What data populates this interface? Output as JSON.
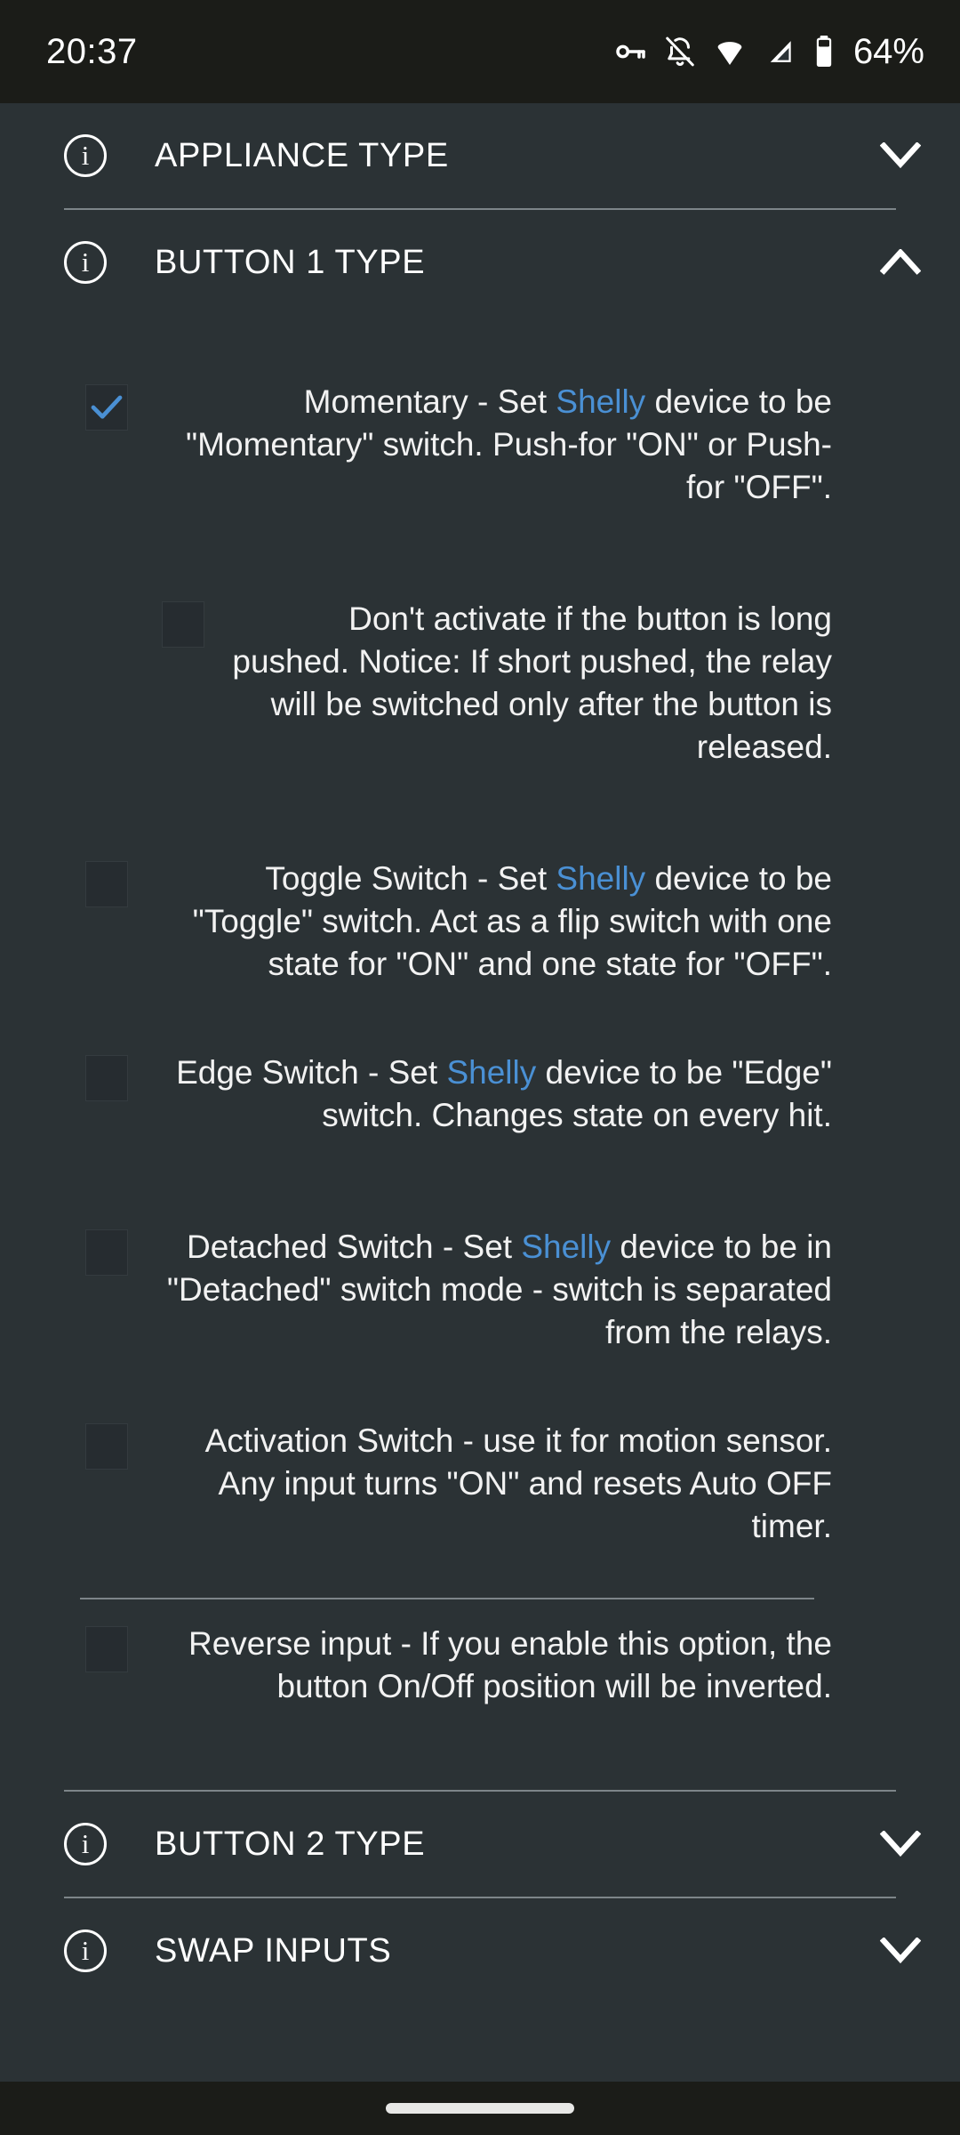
{
  "status_bar": {
    "time": "20:37",
    "battery_percent": "64%",
    "icons": [
      "key-icon",
      "notifications-off-icon",
      "wifi-icon",
      "cellular-signal-icon",
      "battery-icon"
    ]
  },
  "colors": {
    "background": "#2b3235",
    "status_bar_background": "#1b1c18",
    "text": "#f2f2f2",
    "brand_accent": "#4a90d4",
    "divider": "#7d8589",
    "checkbox_fill": "#262c30"
  },
  "sections": [
    {
      "id": "appliance-type",
      "title": "APPLIANCE TYPE",
      "expanded": false,
      "chevron": "chevron-down-icon",
      "info_icon": "info-icon"
    },
    {
      "id": "button-1-type",
      "title": "BUTTON 1 TYPE",
      "expanded": true,
      "chevron": "chevron-up-icon",
      "info_icon": "info-icon"
    },
    {
      "id": "button-2-type",
      "title": "BUTTON 2 TYPE",
      "expanded": false,
      "chevron": "chevron-down-icon",
      "info_icon": "info-icon"
    },
    {
      "id": "swap-inputs",
      "title": "SWAP INPUTS",
      "expanded": false,
      "chevron": "chevron-down-icon",
      "info_icon": "info-icon"
    }
  ],
  "button1_options": [
    {
      "id": "momentary",
      "checked": true,
      "indented": false,
      "text_before": "Momentary - Set ",
      "brand": "Shelly",
      "text_after": " device to be \"Momentary\" switch. Push-for \"ON\" or Push-for \"OFF\"."
    },
    {
      "id": "dont-activate-long-push",
      "checked": false,
      "indented": true,
      "text_before": "Don't activate if the button is long pushed. Notice: If short pushed, the relay will be switched only after the button is released.",
      "brand": "",
      "text_after": ""
    },
    {
      "id": "toggle-switch",
      "checked": false,
      "indented": false,
      "text_before": "Toggle Switch - Set ",
      "brand": "Shelly",
      "text_after": " device to be \"Toggle\" switch. Act as a flip switch with one state for \"ON\" and one state for \"OFF\"."
    },
    {
      "id": "edge-switch",
      "checked": false,
      "indented": false,
      "text_before": "Edge Switch - Set ",
      "brand": "Shelly",
      "text_after": " device to be \"Edge\" switch. Changes state on every hit."
    },
    {
      "id": "detached-switch",
      "checked": false,
      "indented": false,
      "text_before": "Detached Switch - Set ",
      "brand": "Shelly",
      "text_after": " device to be in \"Detached\" switch mode - switch is separated from the relays."
    },
    {
      "id": "activation-switch",
      "checked": false,
      "indented": false,
      "text_before": "Activation Switch - use it for motion sensor. Any input turns \"ON\" and resets Auto OFF timer.",
      "brand": "",
      "text_after": ""
    }
  ],
  "reverse_input": {
    "id": "reverse-input",
    "checked": false,
    "text_before": "Reverse input - If you enable this option, the button On/Off position will be inverted.",
    "brand": "",
    "text_after": ""
  }
}
